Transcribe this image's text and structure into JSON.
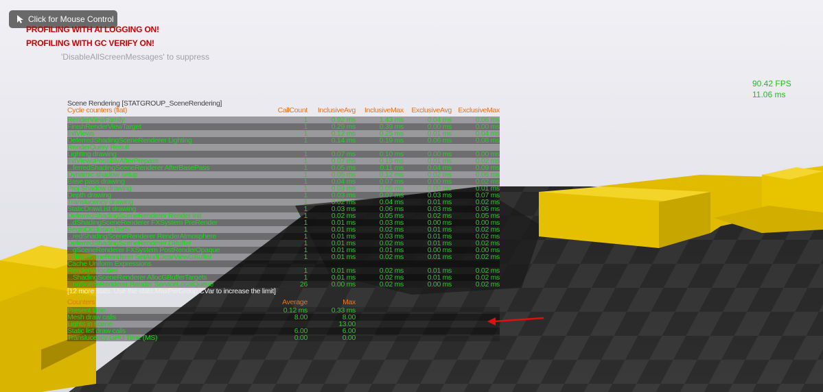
{
  "mouse_control": {
    "label": "Click for Mouse Control"
  },
  "messages": [
    "PROFILING WITH AI LOGGING ON!",
    "PROFILING WITH GC VERIFY ON!"
  ],
  "suppress_hint": "'DisableAllScreenMessages' to suppress",
  "fps": {
    "fps": "90.42 FPS",
    "ms": "11.06 ms"
  },
  "stat_group": {
    "title": "Scene Rendering [STATGROUP_SceneRendering]",
    "headers": [
      "Cycle counters (flat)",
      "CallCount",
      "InclusiveAvg",
      "InclusiveMax",
      "ExclusiveAvg",
      "ExclusiveMax"
    ],
    "rows": [
      [
        "RenderViewFamily",
        "1",
        "0.92 ms",
        "1.43 ms",
        "0.04 ms",
        "0.06 ms"
      ],
      [
        "FinishRenderViewTarget",
        "1",
        "0.29 ms",
        "0.39 ms",
        "0.00 ms",
        "0.00 ms"
      ],
      [
        "InitViews",
        "1",
        "0.12 ms",
        "0.25 ms",
        "0.01 ms",
        "0.04 ms"
      ],
      [
        "DeferredShadingSceneRenderer Lighting",
        "1",
        "0.14 ms",
        "0.19 ms",
        "0.06 ms",
        "0.08 ms"
      ],
      [
        "RenderQuery Result",
        "",
        "",
        "",
        "",
        ""
      ],
      [
        "Lighting drawing",
        "1",
        "0.07 ms",
        "0.10 ms",
        "0.00 ms",
        "0.00 ms"
      ],
      [
        "InitViewsPossiblyAfterPrepass",
        "1",
        "0.07 ms",
        "0.15 ms",
        "0.01 ms",
        "0.02 ms"
      ],
      [
        "...ferredShadingSceneRenderer AfterBasePass",
        "1",
        "0.05 ms",
        "0.11 ms",
        "0.04 ms",
        "0.09 ms"
      ],
      [
        "Dynamic shadow setup",
        "1",
        "0.05 ms",
        "0.12 ms",
        "0.02 ms",
        "0.06 ms"
      ],
      [
        "Base pass drawing",
        "1",
        "0.04 ms",
        "0.07 ms",
        "0.00 ms",
        "0.02 ms"
      ],
      [
        "Proj Shadow drawing",
        "1",
        "0.03 ms",
        "0.05 ms",
        "0.00 ms",
        "0.01 ms"
      ],
      [
        "Depth drawing",
        "1",
        "0.03 ms",
        "0.07 ms",
        "0.03 ms",
        "0.07 ms"
      ],
      [
        "Translucency drawing",
        "1",
        "0.02 ms",
        "0.04 ms",
        "0.01 ms",
        "0.02 ms"
      ],
      [
        "StaticDrawList drawing",
        "1",
        "0.03 ms",
        "0.06 ms",
        "0.03 ms",
        "0.06 ms"
      ],
      [
        "DeferredShadingSceneRenderer Render Init",
        "1",
        "0.02 ms",
        "0.05 ms",
        "0.02 ms",
        "0.05 ms"
      ],
      [
        "...dShadingSceneRenderer FXSystem PreRender",
        "1",
        "0.01 ms",
        "0.03 ms",
        "0.00 ms",
        "0.00 ms"
      ],
      [
        "BeginOcclusionTests",
        "1",
        "0.01 ms",
        "0.02 ms",
        "0.01 ms",
        "0.02 ms"
      ],
      [
        "...redShadingSceneRenderer RenderAtmosphere",
        "1",
        "0.01 ms",
        "0.03 ms",
        "0.01 ms",
        "0.02 ms"
      ],
      [
        "DeferredShadingSceneRenderer DBuffer",
        "1",
        "0.01 ms",
        "0.02 ms",
        "0.01 ms",
        "0.02 ms"
      ],
      [
        "...gSceneRenderer FXSystem PostRenderOpaque",
        "1",
        "0.01 ms",
        "0.01 ms",
        "0.00 ms",
        "0.00 ms"
      ],
      [
        "...dingSceneRenderer SetAndClearViewGBuffer",
        "1",
        "0.01 ms",
        "0.02 ms",
        "0.01 ms",
        "0.02 ms"
      ],
      [
        "Cache Uniform Expressions",
        "",
        "",
        "",
        "",
        ""
      ],
      [
        "RenderVelocities",
        "1",
        "0.01 ms",
        "0.02 ms",
        "0.01 ms",
        "0.02 ms"
      ],
      [
        "...ShadingSceneRenderer AllocGBufferTargets",
        "1",
        "0.01 ms",
        "0.02 ms",
        "0.01 ms",
        "0.02 ms"
      ],
      [
        "...ngSceneRenderer Render ServiceLocalQueue",
        "26",
        "0.00 ms",
        "0.02 ms",
        "0.00 ms",
        "0.02 ms"
      ]
    ],
    "more_stats": "[12 more stats. Use the stats.MaxPerGroup CVar to increase the limit]",
    "counters": {
      "headers": [
        "Counters",
        "Average",
        "Max"
      ],
      "rows": [
        [
          "Present time",
          "0.12 ms",
          "0.33 ms"
        ],
        [
          "Mesh draw calls",
          "8.00",
          "8.00"
        ],
        [
          "Lights in scene",
          "",
          "13.00"
        ],
        [
          "Static list draw calls",
          "6.00",
          "6.00"
        ],
        [
          "Translucency GPU Time (MS)",
          "0.00",
          "0.00"
        ]
      ]
    }
  },
  "colors": {
    "stat_green": "#1fd21f",
    "header_orange": "#e8731c",
    "warning_red": "#c80000",
    "arrow_red": "#e01010",
    "block_yellow": "#e8c400"
  }
}
